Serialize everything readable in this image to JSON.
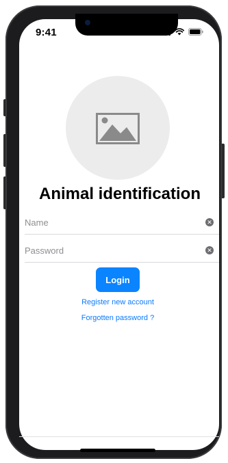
{
  "status_bar": {
    "time": "9:41",
    "icons": [
      "signal-icon",
      "wifi-icon",
      "battery-icon"
    ]
  },
  "header": {
    "image_placeholder_icon": "image-icon",
    "title": "Animal identification"
  },
  "form": {
    "name": {
      "placeholder": "Name",
      "value": ""
    },
    "password": {
      "placeholder": "Password",
      "value": ""
    },
    "clear_icon": "clear-icon"
  },
  "actions": {
    "login_label": "Login",
    "register_label": "Register new account",
    "forgot_label": "Forgotten password ?"
  },
  "colors": {
    "accent": "#0a84ff",
    "placeholder_circle": "#ececec",
    "phone_frame": "#1c1c1e"
  }
}
